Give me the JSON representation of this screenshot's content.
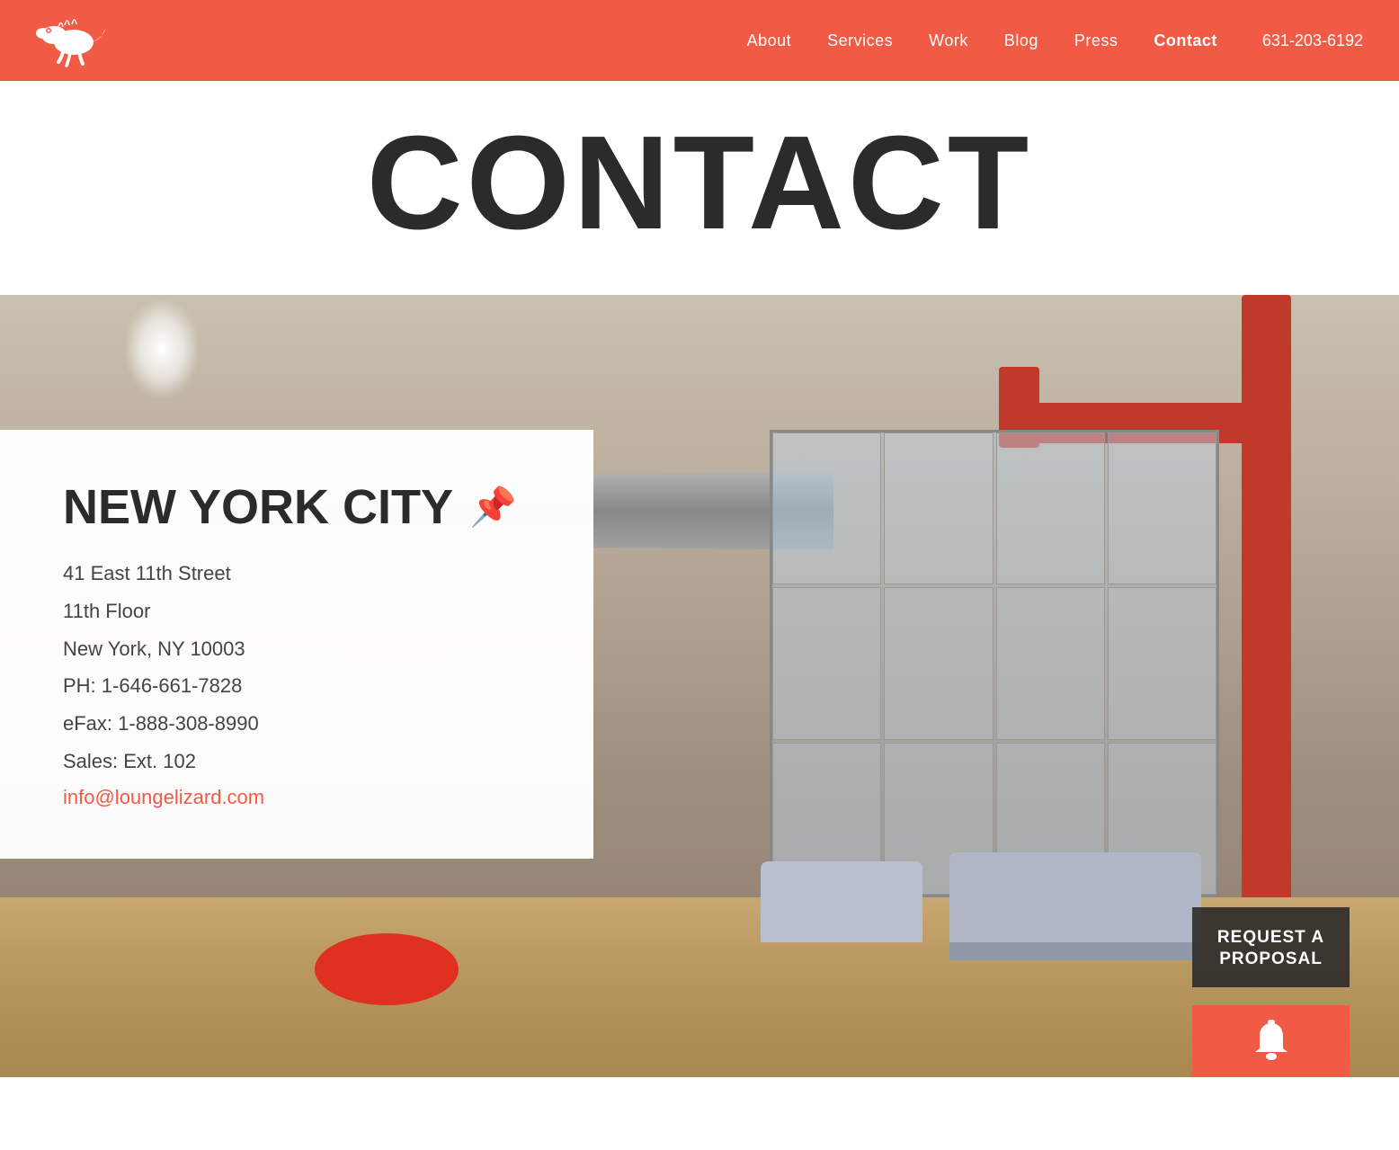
{
  "header": {
    "logo_alt": "Lounge Lizard logo",
    "nav": {
      "about": "About",
      "services": "Services",
      "work": "Work",
      "blog": "Blog",
      "press": "Press",
      "contact": "Contact",
      "phone": "631-203-6192"
    }
  },
  "page_title": "CONTACT",
  "office": {
    "city": "NEW YORK CITY",
    "address_line1": "41 East 11th Street",
    "address_line2": "11th Floor",
    "address_line3": "New York, NY 10003",
    "phone": "PH: 1-646-661-7828",
    "efax": "eFax: 1-888-308-8990",
    "sales": "Sales: Ext. 102",
    "email": "info@loungelizard.com"
  },
  "cta": {
    "request_line1": "REQUEST A",
    "request_line2": "PROPOSAL"
  },
  "icons": {
    "pin": "📌",
    "bell": "🔔"
  }
}
